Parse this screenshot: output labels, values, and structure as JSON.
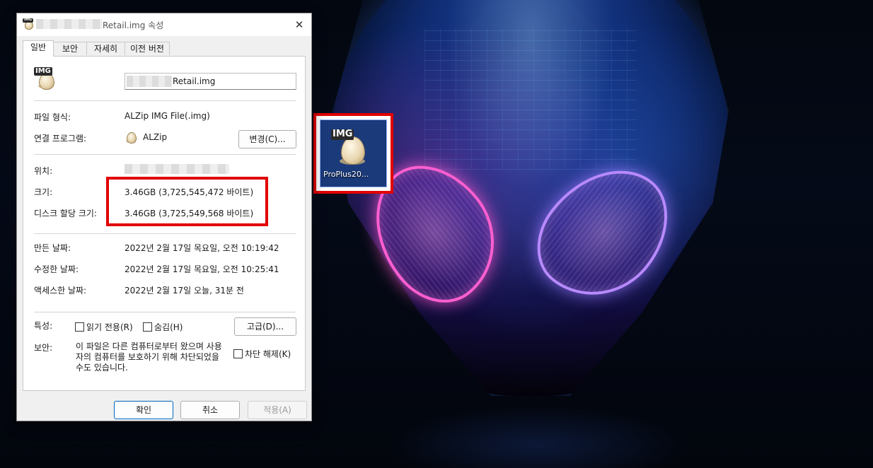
{
  "dialog": {
    "title_suffix": "Retail.img 속성",
    "close_glyph": "✕",
    "tabs": [
      "일반",
      "보안",
      "자세히",
      "이전 버전"
    ],
    "icon_tag": "IMG",
    "file_name_visible": "Retail.img",
    "file_type_label": "파일 형식:",
    "file_type_value": "ALZip IMG File(.img)",
    "opens_with_label": "연결 프로그램:",
    "opens_with_value": "ALZip",
    "change_button": "변경(C)...",
    "location_label": "위치:",
    "size_label": "크기:",
    "size_value": "3.46GB (3,725,545,472 바이트)",
    "size_on_disk_label": "디스크 할당 크기:",
    "size_on_disk_value": "3.46GB (3,725,549,568 바이트)",
    "created_label": "만든 날짜:",
    "created_value": "2022년 2월 17일 목요일, 오전 10:19:42",
    "modified_label": "수정한 날짜:",
    "modified_value": "2022년 2월 17일 목요일, 오전 10:25:41",
    "accessed_label": "액세스한 날짜:",
    "accessed_value": "2022년 2월 17일 오늘, 31분 전",
    "attributes_label": "특성:",
    "readonly_label": "읽기 전용(R)",
    "hidden_label": "숨김(H)",
    "advanced_button": "고급(D)...",
    "security_label": "보안:",
    "security_text": "이 파일은 다른 컴퓨터로부터 왔으며 사용자의 컴퓨터를 보호하기 위해 차단되었을 수도 있습니다.",
    "unblock_label": "차단 해제(K)",
    "ok_button": "확인",
    "cancel_button": "취소",
    "apply_button": "적용(A)"
  },
  "desktop_icon": {
    "tag": "IMG",
    "caption": "ProPlus20..."
  },
  "colors": {
    "highlight": "#e10000",
    "dialog_bg": "#f0f0f0"
  }
}
